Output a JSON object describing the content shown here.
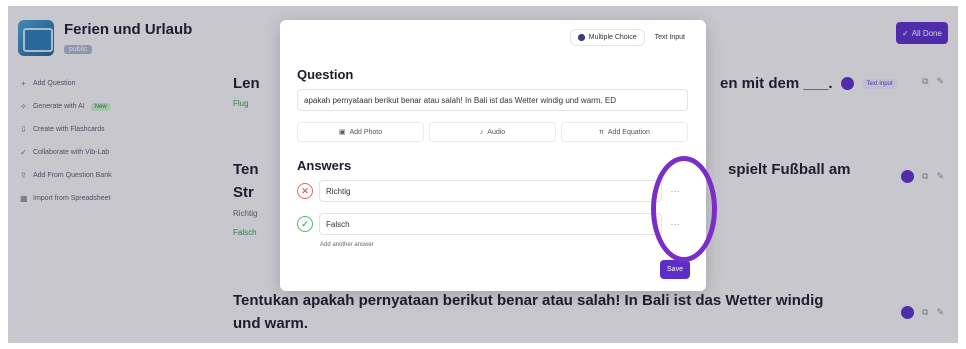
{
  "quiz": {
    "title": "Ferien und Urlaub",
    "chip": "public"
  },
  "sidebar": {
    "items": [
      {
        "icon": "+",
        "label": "Add Question"
      },
      {
        "icon": "✧",
        "label": "Generate with AI",
        "badge": "New"
      },
      {
        "icon": "⇩",
        "label": "Create with Flashcards"
      },
      {
        "icon": "✓",
        "label": "Collaborate with Vib-Lab"
      },
      {
        "icon": "⇪",
        "label": "Add From Question Bank"
      },
      {
        "icon": "▦",
        "label": "Import from Spreadsheet"
      }
    ]
  },
  "header": {
    "all_done_label": "All Done"
  },
  "background_questions": [
    {
      "text_left": "Len",
      "text_right": "en mit dem ___.",
      "chip": "Text Input",
      "sub": "Flug"
    },
    {
      "text_left": "Ten",
      "text_right": "spielt Fußball am",
      "line2": "Str",
      "sub1": "Richtig",
      "sub2": "Falsch"
    },
    {
      "text": "Tentukan apakah pernyataan berikut benar atau salah! In Bali ist das Wetter windig",
      "line2": "und warm."
    }
  ],
  "modal": {
    "modes": [
      {
        "label": "Multiple Choice",
        "active": true
      },
      {
        "label": "Text Input",
        "active": false
      }
    ],
    "question_heading": "Question",
    "question_value": "apakah pernyataan berikut benar atau salah! In Bali ist das Wetter windig und warm. ED",
    "tools": [
      {
        "icon": "▣",
        "label": "Add Photo"
      },
      {
        "icon": "♪",
        "label": "Audio"
      },
      {
        "icon": "π",
        "label": "Add Equation"
      }
    ],
    "answers_heading": "Answers",
    "answers": [
      {
        "text": "Richtig",
        "correct": false,
        "mark": "✕",
        "menu": "···"
      },
      {
        "text": "Falsch",
        "correct": true,
        "mark": "✓",
        "menu": "···"
      }
    ],
    "add_answer_label": "Add another answer",
    "save_label": "Save"
  },
  "colors": {
    "accent": "#5a2fc9",
    "annotation": "#7a2ec7",
    "wrong": "#e5675f",
    "right": "#4dba6a"
  }
}
